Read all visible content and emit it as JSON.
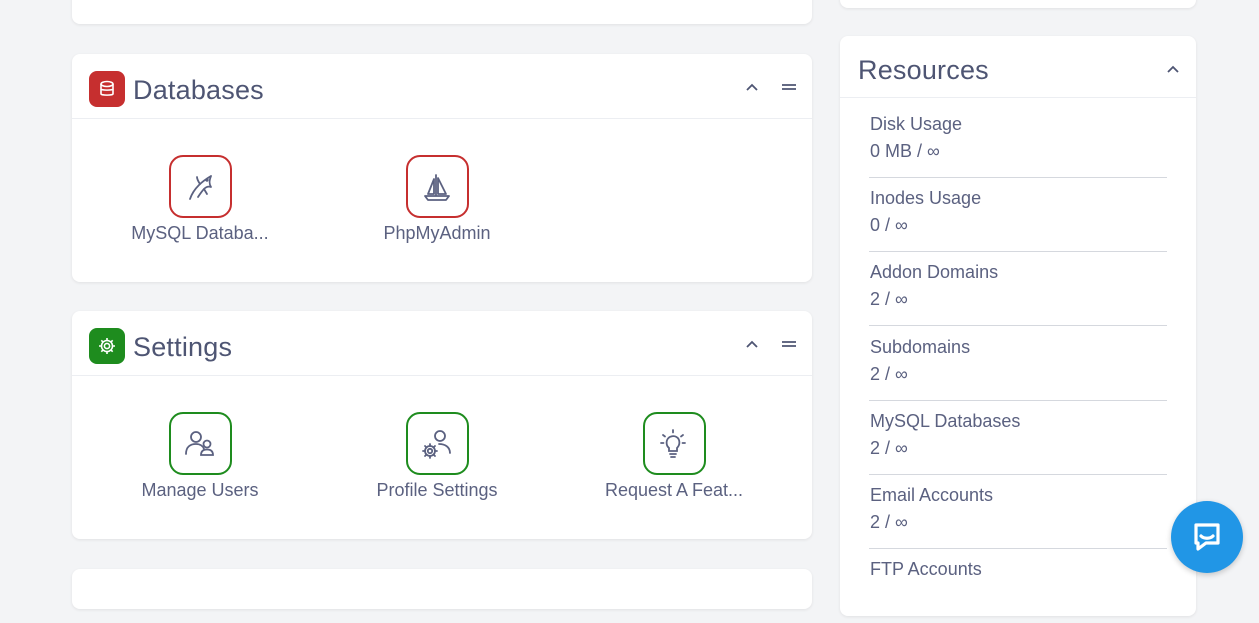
{
  "databases": {
    "title": "Databases",
    "color": "#c62f2f",
    "apps": [
      {
        "label": "MySQL Databa...",
        "icon": "dolphin-icon"
      },
      {
        "label": "PhpMyAdmin",
        "icon": "sailboat-icon"
      }
    ]
  },
  "settings": {
    "title": "Settings",
    "color": "#1e8c1e",
    "apps": [
      {
        "label": "Manage Users",
        "icon": "users-icon"
      },
      {
        "label": "Profile Settings",
        "icon": "user-gear-icon"
      },
      {
        "label": "Request A Feat...",
        "icon": "lightbulb-icon"
      }
    ]
  },
  "resources": {
    "title": "Resources",
    "items": [
      {
        "name": "Disk Usage",
        "value": "0 MB / ∞"
      },
      {
        "name": "Inodes Usage",
        "value": "0 / ∞"
      },
      {
        "name": "Addon Domains",
        "value": "2 / ∞"
      },
      {
        "name": "Subdomains",
        "value": "2 / ∞"
      },
      {
        "name": "MySQL Databases",
        "value": "2 / ∞"
      },
      {
        "name": "Email Accounts",
        "value": "2 / ∞"
      },
      {
        "name": "FTP Accounts",
        "value": ""
      }
    ]
  },
  "chat": {
    "icon": "chat-bubble-icon",
    "color": "#2196e6"
  }
}
